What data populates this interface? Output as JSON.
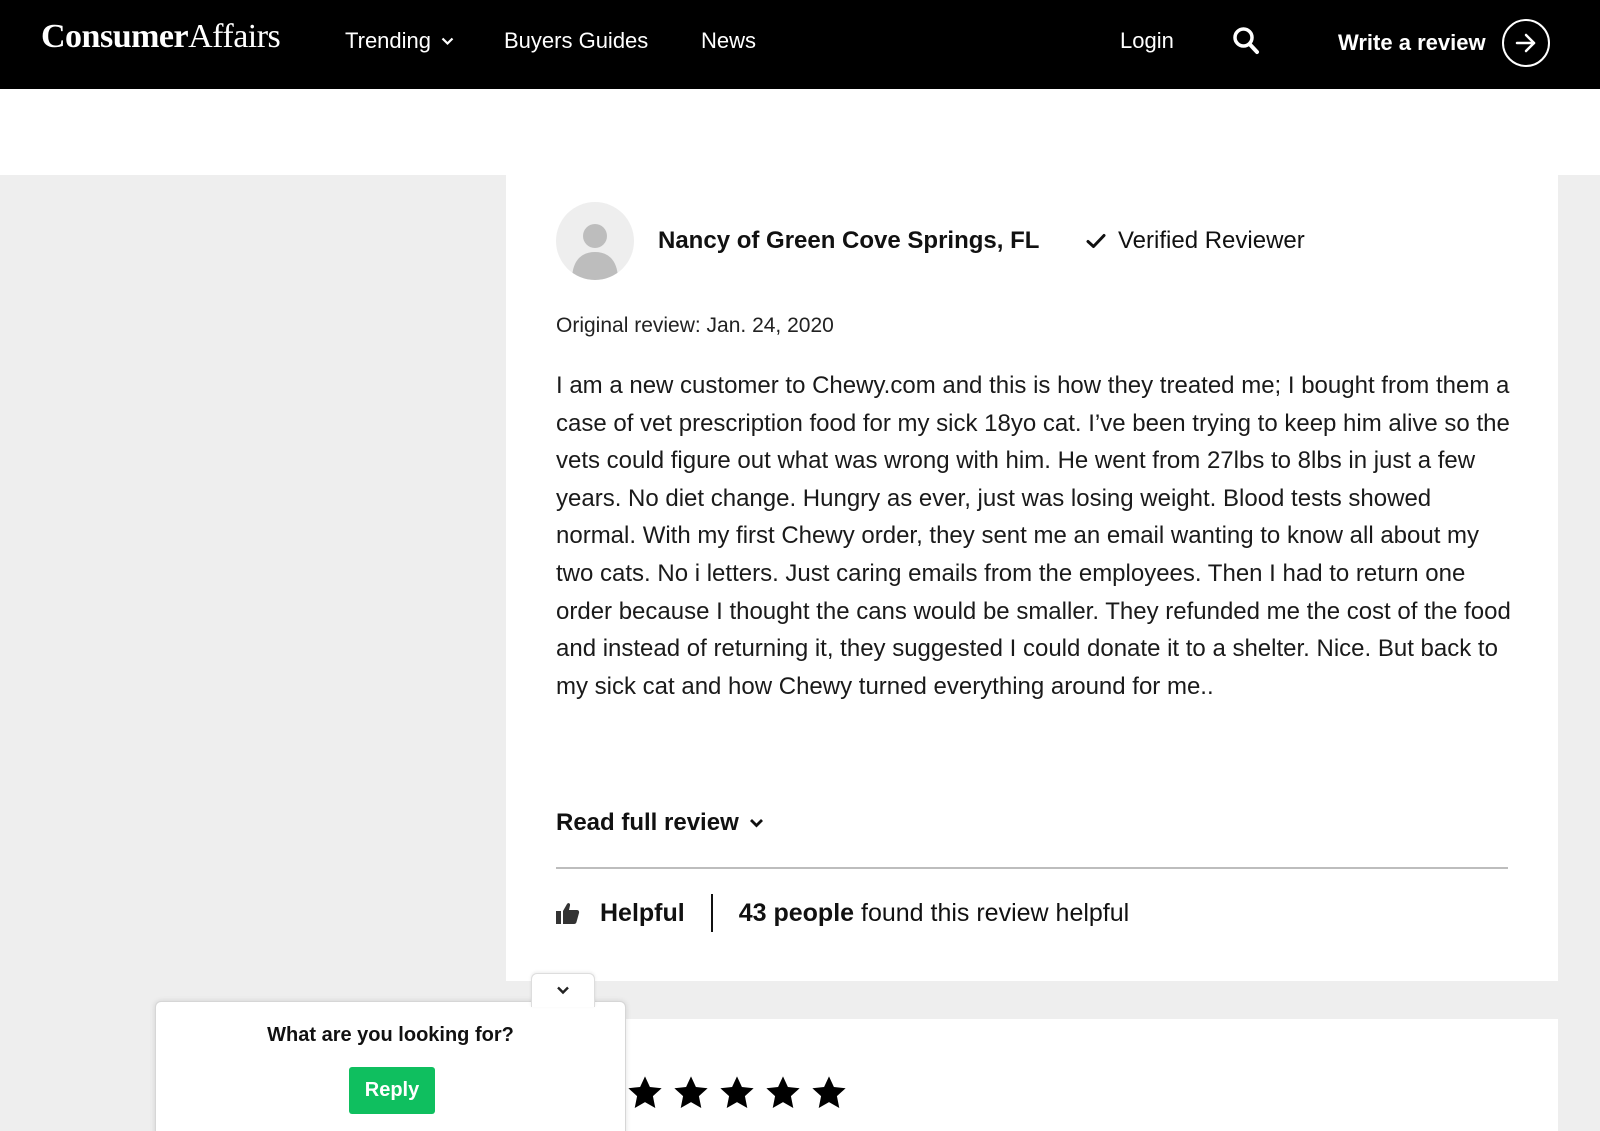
{
  "header": {
    "logo_bold": "Consumer",
    "logo_regular": "Affairs",
    "nav": {
      "trending": "Trending",
      "buyers_guides": "Buyers Guides",
      "news": "News",
      "login": "Login",
      "write_review": "Write a review"
    }
  },
  "review": {
    "reviewer_name": "Nancy of Green Cove Springs, FL",
    "verified_label": "Verified Reviewer",
    "date": "Original review: Jan. 24, 2020",
    "body": "I am a new customer to Chewy.com and this is how they treated me; I bought from them a case of vet prescription food for my sick 18yo cat. I’ve been trying to keep him alive so the vets could figure out what was wrong with him. He went from 27lbs to 8lbs in just a few years. No diet change. Hungry as ever, just was losing weight. Blood tests showed normal. With my first Chewy order, they sent me an email wanting to know all about my two cats. No i letters. Just caring emails from the employees. Then I had to return one order because I thought the cans would be smaller. They refunded me the cost of the food and instead of returning it, they suggested I could donate it to a shelter. Nice. But back to my sick cat and how Chewy turned everything around for me..",
    "read_full": "Read full review",
    "helpful_label": "Helpful",
    "helpful_count": "43 people",
    "helpful_suffix": " found this review helpful"
  },
  "next_review": {
    "rating": 5
  },
  "popup": {
    "question": "What are you looking for?",
    "reply_label": "Reply"
  },
  "colors": {
    "header_bg": "#000000",
    "page_gray": "#eeeeee",
    "reply_green": "#0fbf5f"
  },
  "icons": [
    "chevron-down-icon",
    "search-icon",
    "arrow-right-icon",
    "avatar-icon",
    "checkmark-icon",
    "thumbs-up-icon",
    "star-icon"
  ]
}
